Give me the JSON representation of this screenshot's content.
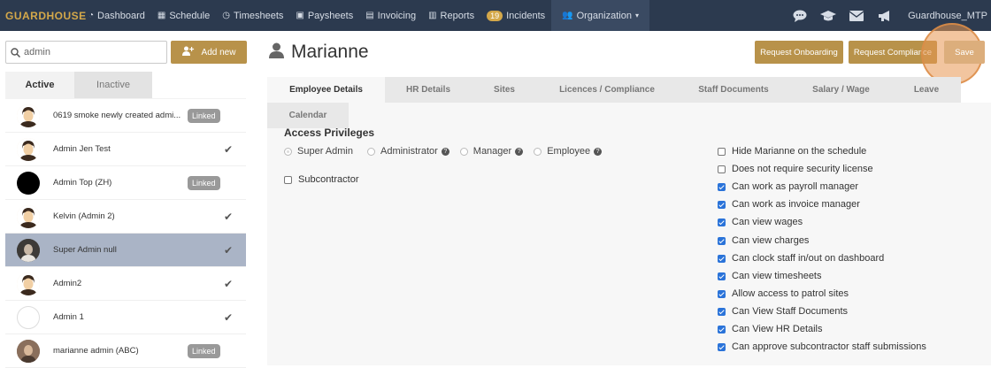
{
  "nav": {
    "brand": "GUARDHOUSE",
    "items": [
      {
        "label": "Dashboard",
        "icon": "dashboard-icon"
      },
      {
        "label": "Schedule",
        "icon": "calendar-icon"
      },
      {
        "label": "Timesheets",
        "icon": "clock-icon"
      },
      {
        "label": "Paysheets",
        "icon": "money-icon"
      },
      {
        "label": "Invoicing",
        "icon": "invoice-icon"
      },
      {
        "label": "Reports",
        "icon": "report-icon"
      },
      {
        "label": "Incidents",
        "icon": "incident-icon",
        "badge": "19"
      },
      {
        "label": "Organization",
        "icon": "users-icon"
      }
    ],
    "user": "Guardhouse_MTP"
  },
  "left": {
    "search_value": "admin",
    "add_label": "Add new",
    "tabs": [
      "Active",
      "Inactive"
    ],
    "linked_label": "Linked",
    "rows": [
      {
        "name": "0619 smoke newly created admi...",
        "status": "linked"
      },
      {
        "name": "Admin Jen Test",
        "status": "check"
      },
      {
        "name": "Admin Top (ZH)",
        "status": "linked"
      },
      {
        "name": "Kelvin (Admin 2)",
        "status": "check"
      },
      {
        "name": "Super Admin null",
        "status": "check"
      },
      {
        "name": "Admin2",
        "status": "check"
      },
      {
        "name": "Admin 1",
        "status": "check"
      },
      {
        "name": "marianne admin (ABC)",
        "status": "linked"
      }
    ]
  },
  "main": {
    "title": "Marianne",
    "buttons": {
      "onboarding": "Request Onboarding",
      "compliance": "Request Compliance",
      "save": "Save"
    },
    "tabs": [
      "Employee Details",
      "HR Details",
      "Sites",
      "Licences / Compliance",
      "Staff Documents",
      "Salary / Wage",
      "Leave"
    ],
    "tab_row2": "Calendar",
    "section_title": "Access Privileges",
    "roles": [
      "Super Admin",
      "Administrator",
      "Manager",
      "Employee"
    ],
    "subcontractor": "Subcontractor",
    "permissions": [
      {
        "label": "Hide Marianne on the schedule",
        "checked": false
      },
      {
        "label": "Does not require security license",
        "checked": false
      },
      {
        "label": "Can work as payroll manager",
        "checked": true
      },
      {
        "label": "Can work as invoice manager",
        "checked": true
      },
      {
        "label": "Can view wages",
        "checked": true
      },
      {
        "label": "Can view charges",
        "checked": true
      },
      {
        "label": "Can clock staff in/out on dashboard",
        "checked": true
      },
      {
        "label": "Can view timesheets",
        "checked": true
      },
      {
        "label": "Allow access to patrol sites",
        "checked": true
      },
      {
        "label": "Can View Staff Documents",
        "checked": true
      },
      {
        "label": "Can View HR Details",
        "checked": true
      },
      {
        "label": "Can approve subcontractor staff submissions",
        "checked": true
      }
    ]
  },
  "colors": {
    "navbar": "#2c3a4f",
    "accent": "#b8924a",
    "brand": "#d4a84a",
    "checkbox": "#2a73d9"
  }
}
